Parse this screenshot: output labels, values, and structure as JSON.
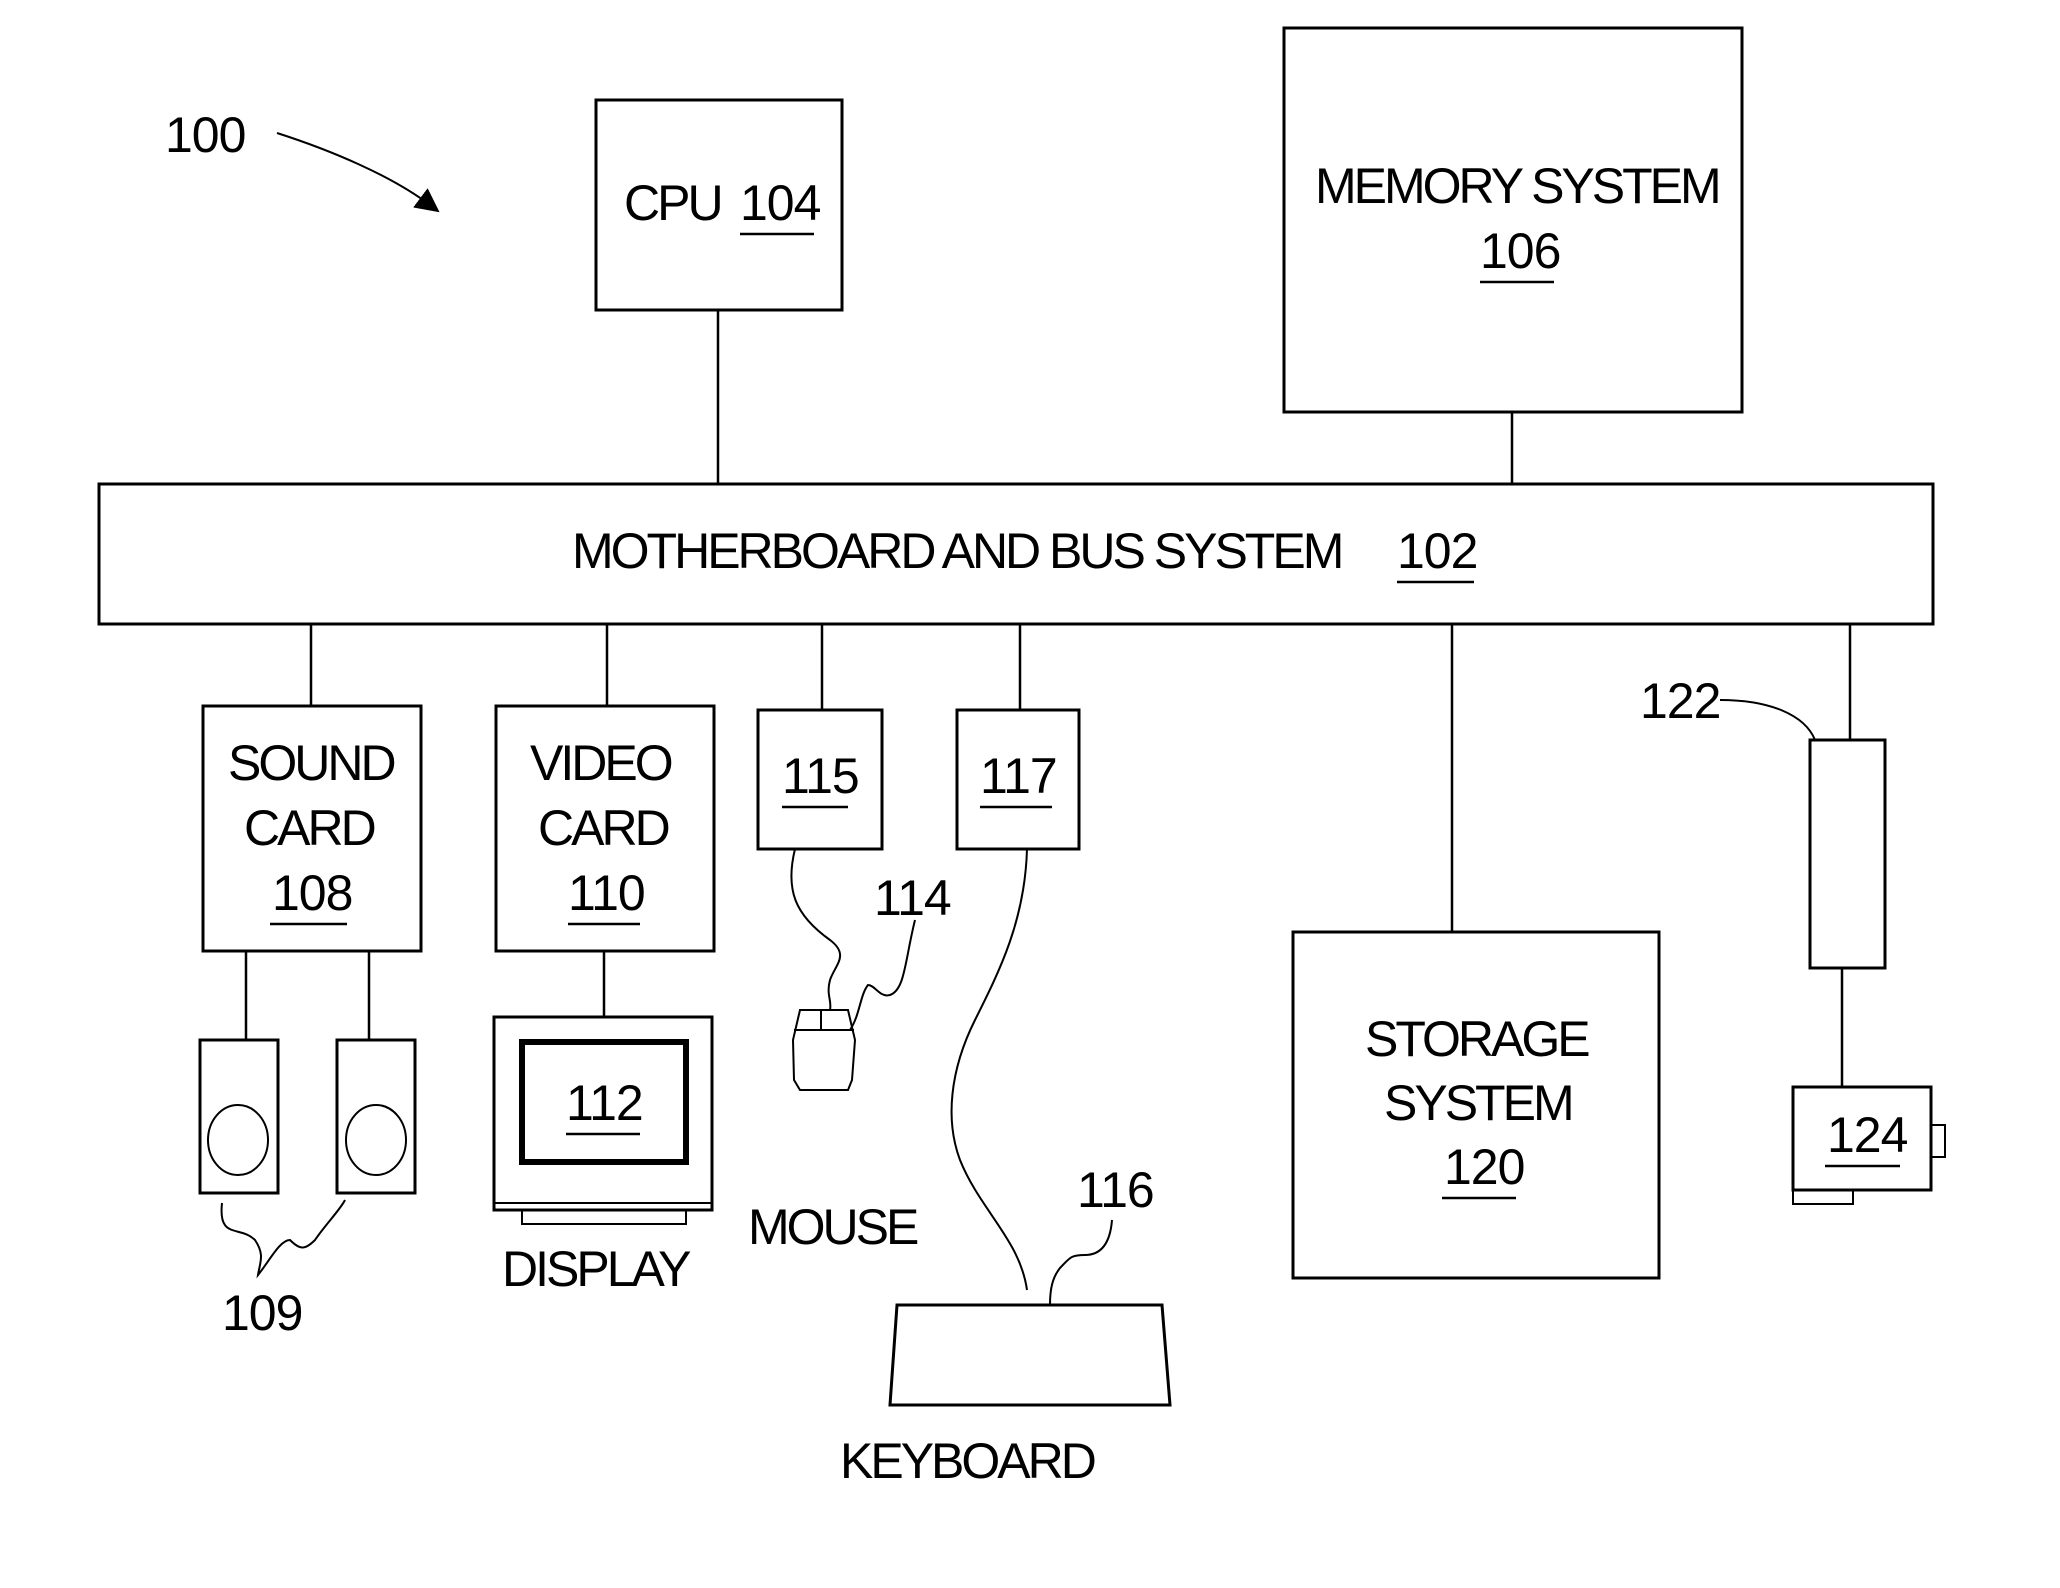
{
  "figure": {
    "ref": "100",
    "cpu": {
      "label": "CPU",
      "ref": "104"
    },
    "memory": {
      "label": "MEMORY SYSTEM",
      "ref": "106"
    },
    "bus": {
      "label": "MOTHERBOARD AND BUS SYSTEM",
      "ref": "102"
    },
    "sound_card": {
      "line1": "SOUND",
      "line2": "CARD",
      "ref": "108"
    },
    "speakers": {
      "ref": "109"
    },
    "video_card": {
      "line1": "VIDEO",
      "line2": "CARD",
      "ref": "110"
    },
    "display": {
      "label": "DISPLAY",
      "ref": "112"
    },
    "mouse_port": {
      "ref": "115"
    },
    "mouse": {
      "label": "MOUSE",
      "ref": "114"
    },
    "keyboard_port": {
      "ref": "117"
    },
    "keyboard": {
      "label": "KEYBOARD",
      "ref": "116"
    },
    "storage": {
      "line1": "STORAGE",
      "line2": "SYSTEM",
      "ref": "120"
    },
    "adapter": {
      "ref": "122"
    },
    "camera": {
      "ref": "124"
    }
  }
}
